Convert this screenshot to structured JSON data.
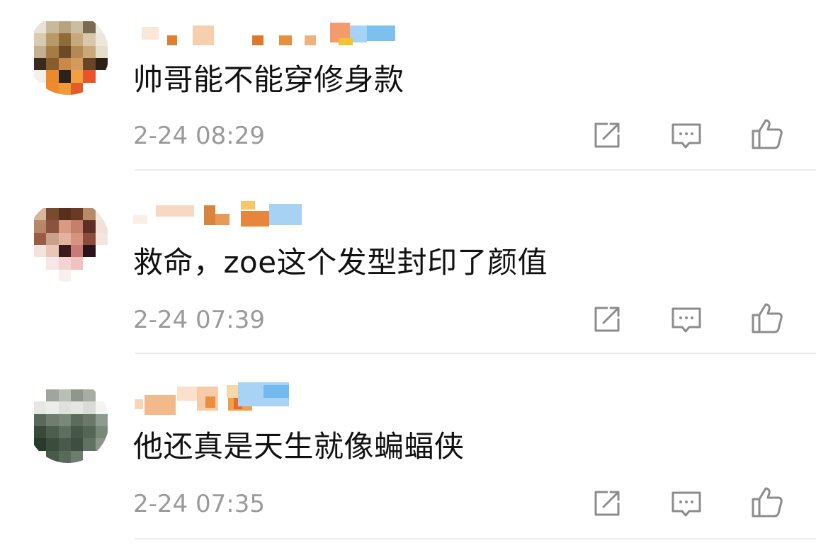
{
  "comments": [
    {
      "text": "帅哥能不能穿修身款",
      "time": "2-24 08:29"
    },
    {
      "text": "救命，zoe这个发型封印了颜值",
      "time": "2-24 07:39"
    },
    {
      "text": "他还真是天生就像蝙蝠侠",
      "time": "2-24 07:35"
    }
  ],
  "actions": {
    "share_icon": "share-square-icon",
    "comment_icon": "comment-bubble-icon",
    "like_icon": "thumbs-up-icon"
  },
  "colors": {
    "text": "#111111",
    "timestamp": "#9a9a9a",
    "icon": "#8c8c8c",
    "divider": "#ececec"
  }
}
